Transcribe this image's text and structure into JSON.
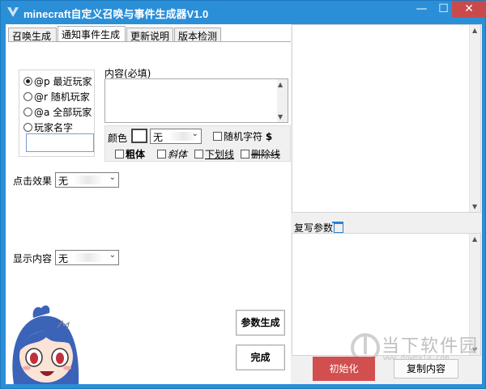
{
  "window": {
    "title": "minecraft自定义召唤与事件生成器V1.0",
    "minimize": "—",
    "maximize": "☐",
    "close": "✕"
  },
  "tabs": [
    "召唤生成",
    "通知事件生成",
    "更新说明",
    "版本检测"
  ],
  "active_tab": 1,
  "target": {
    "options": [
      {
        "code": "@p",
        "label": "最近玩家",
        "checked": true
      },
      {
        "code": "@r",
        "label": "随机玩家",
        "checked": false
      },
      {
        "code": "@a",
        "label": "全部玩家",
        "checked": false
      },
      {
        "code": "",
        "label": "玩家名字",
        "checked": false
      }
    ],
    "name_value": ""
  },
  "content": {
    "label": "内容(必填)",
    "value": ""
  },
  "format": {
    "color_label": "颜色",
    "color_value": "无",
    "random_char_label": "随机字符",
    "random_char_symbol": "$",
    "bold": "粗体",
    "italic": "斜体",
    "underline": "下划线",
    "strikethrough": "删除线"
  },
  "click_effect": {
    "label": "点击效果",
    "value": "无"
  },
  "display_content": {
    "label": "显示内容",
    "value": "无"
  },
  "buttons": {
    "generate": "参数生成",
    "done": "完成",
    "init": "初始化",
    "copy": "复制内容"
  },
  "rewrite": {
    "label": "复写参数"
  },
  "watermark": {
    "text": "当下软件园",
    "sub": "www.downxia.com"
  },
  "colors": {
    "titlebar": "#2b8fd8",
    "close": "#c94a4a",
    "init_button": "#d24f4f"
  }
}
